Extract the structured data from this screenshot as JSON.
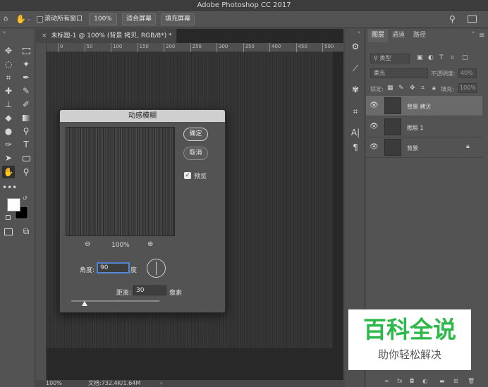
{
  "window": {
    "title": "Adobe Photoshop CC 2017"
  },
  "options_bar": {
    "scroll_all_label": "滚动所有窗口",
    "zoom_value": "100%",
    "fit_screen": "适合屏幕",
    "fill_screen": "填充屏幕"
  },
  "document": {
    "tab_label": "未标题-1 @ 100% (背景 拷贝, RGB/8*) *",
    "ruler_ticks": [
      "0",
      "50",
      "100",
      "150",
      "200",
      "250",
      "300",
      "350",
      "400",
      "450",
      "500"
    ],
    "status_zoom": "100%",
    "status_doc": "文档:732.4K/1.64M"
  },
  "dialog": {
    "title": "动感模糊",
    "ok": "确定",
    "cancel": "取消",
    "preview_label": "预览",
    "zoom_level": "100%",
    "angle_label": "角度:",
    "angle_value": "90",
    "angle_unit": "度",
    "distance_label": "距离:",
    "distance_value": "30",
    "distance_unit": "像素",
    "distance_slider_fraction": 0.15
  },
  "layers_panel": {
    "tabs": [
      "图层",
      "通道",
      "路径"
    ],
    "kind_filter": "类型",
    "blend_mode": "柔光",
    "opacity_label": "不透明度:",
    "opacity_value": "40%",
    "lock_label": "锁定:",
    "fill_label": "填充:",
    "fill_value": "100%",
    "layers": [
      {
        "name": "背景 拷贝",
        "selected": true
      },
      {
        "name": "图层 1",
        "selected": false
      },
      {
        "name": "背景",
        "selected": false,
        "locked": true
      }
    ]
  },
  "watermark": {
    "title": "百科全说",
    "subtitle": "助你轻松解决"
  }
}
